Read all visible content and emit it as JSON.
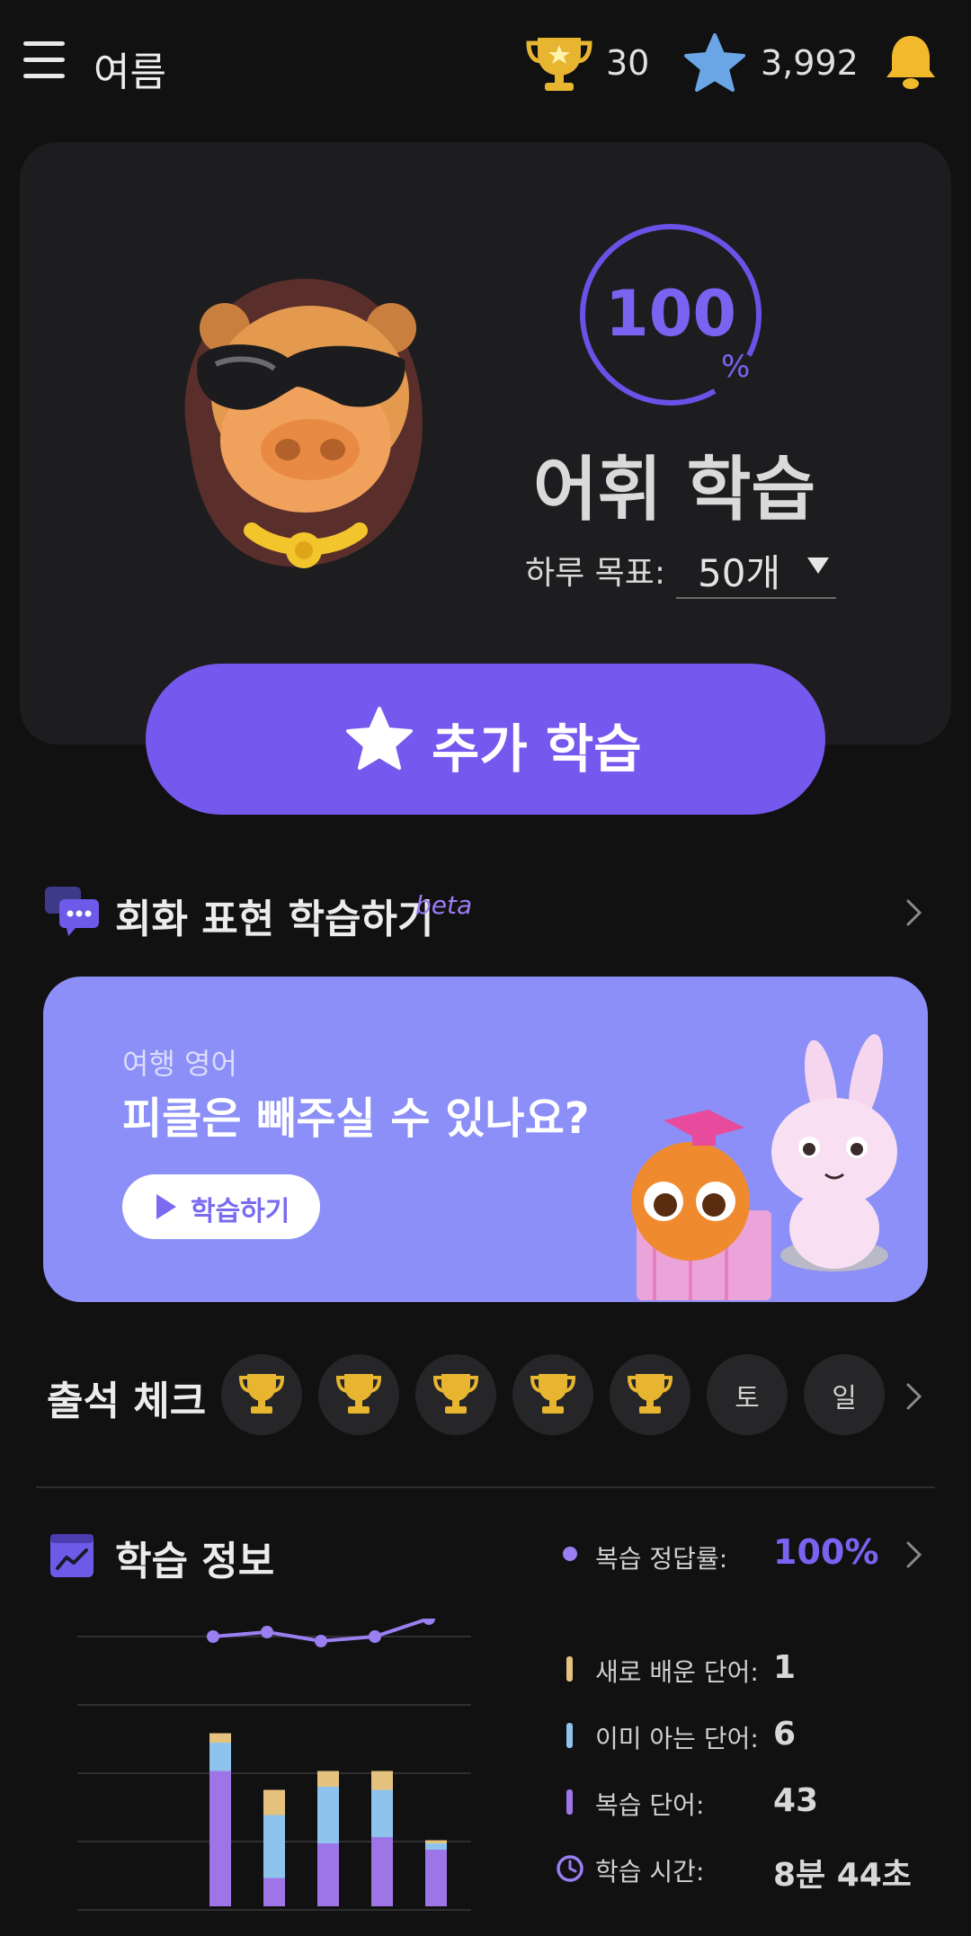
{
  "header": {
    "username": "여름",
    "trophy_count": "30",
    "star_count": "3,992",
    "icons": [
      "menu-icon",
      "trophy-icon",
      "star-icon",
      "bell-icon"
    ]
  },
  "hero": {
    "progress_value": "100",
    "progress_unit": "%",
    "progress_fraction": 1.0,
    "title": "어휘 학습",
    "goal_label": "하루 목표:",
    "goal_value": "50개",
    "extra_button_label": "추가 학습"
  },
  "conversation": {
    "title": "회화 표현 학습하기",
    "badge": "beta",
    "card": {
      "category": "여행 영어",
      "question": "피클은 빼주실 수 있나요?",
      "button_label": "학습하기"
    }
  },
  "attendance": {
    "title": "출석 체크",
    "days": [
      {
        "type": "trophy",
        "label": ""
      },
      {
        "type": "trophy",
        "label": ""
      },
      {
        "type": "trophy",
        "label": ""
      },
      {
        "type": "trophy",
        "label": ""
      },
      {
        "type": "trophy",
        "label": ""
      },
      {
        "type": "text",
        "label": "토"
      },
      {
        "type": "text",
        "label": "일"
      }
    ]
  },
  "learning_info": {
    "title": "학습 정보",
    "accuracy_label": "복습 정답률:",
    "accuracy_value": "100%",
    "stats": [
      {
        "label": "새로 배운 단어:",
        "value": "1",
        "color": "#e6c27f"
      },
      {
        "label": "이미 아는 단어:",
        "value": "6",
        "color": "#8ec3ee"
      },
      {
        "label": "복습 단어:",
        "value": "43",
        "color": "#9d75e6"
      }
    ],
    "time_label": "학습 시간:",
    "time_value": "8분 44초"
  },
  "colors": {
    "accent": "#7558ee",
    "new_words": "#e6c27f",
    "known_words": "#8ec3ee",
    "review_words": "#9d75e6",
    "background": "#111112",
    "card": "#1d1d1f",
    "lesson_card": "#8b8ff7"
  },
  "chart_data": {
    "type": "bar",
    "stacked": true,
    "categories": [
      "",
      "",
      "",
      "",
      ""
    ],
    "series": [
      {
        "name": "복습 단어",
        "values": [
          43,
          9,
          20,
          22,
          18
        ],
        "color": "#9d75e6"
      },
      {
        "name": "이미 아는 단어",
        "values": [
          9,
          20,
          18,
          15,
          2
        ],
        "color": "#8ec3ee"
      },
      {
        "name": "새로 배운 단어",
        "values": [
          3,
          8,
          5,
          6,
          1
        ],
        "color": "#e6c27f"
      }
    ],
    "line_series": {
      "name": "복습 정답률",
      "values": [
        96,
        97,
        95,
        96,
        100
      ],
      "ylim": [
        0,
        100
      ],
      "color": "#9a7ff0"
    },
    "ylim": [
      0,
      60
    ],
    "grid": true
  }
}
